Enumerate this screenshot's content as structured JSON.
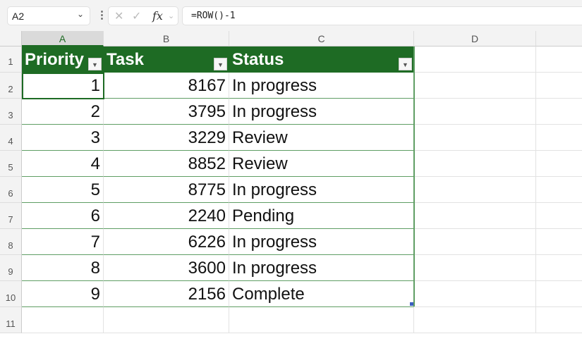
{
  "formula_bar": {
    "name_box": "A2",
    "formula": "=ROW()-1",
    "cancel_icon": "✕",
    "enter_icon": "✓",
    "fx_label": "fx"
  },
  "columns": [
    "A",
    "B",
    "C",
    "D"
  ],
  "rows": [
    "1",
    "2",
    "3",
    "4",
    "5",
    "6",
    "7",
    "8",
    "9",
    "10",
    "11"
  ],
  "table": {
    "headers": [
      "Priority",
      "Task",
      "Status"
    ],
    "data": [
      [
        "1",
        "8167",
        "In progress"
      ],
      [
        "2",
        "3795",
        "In progress"
      ],
      [
        "3",
        "3229",
        "Review"
      ],
      [
        "4",
        "8852",
        "Review"
      ],
      [
        "5",
        "8775",
        "In progress"
      ],
      [
        "6",
        "2240",
        "Pending"
      ],
      [
        "7",
        "6226",
        "In progress"
      ],
      [
        "8",
        "3600",
        "In progress"
      ],
      [
        "9",
        "2156",
        "Complete"
      ]
    ]
  },
  "colors": {
    "header_green": "#1e6b24",
    "table_border": "#5f9e64"
  }
}
